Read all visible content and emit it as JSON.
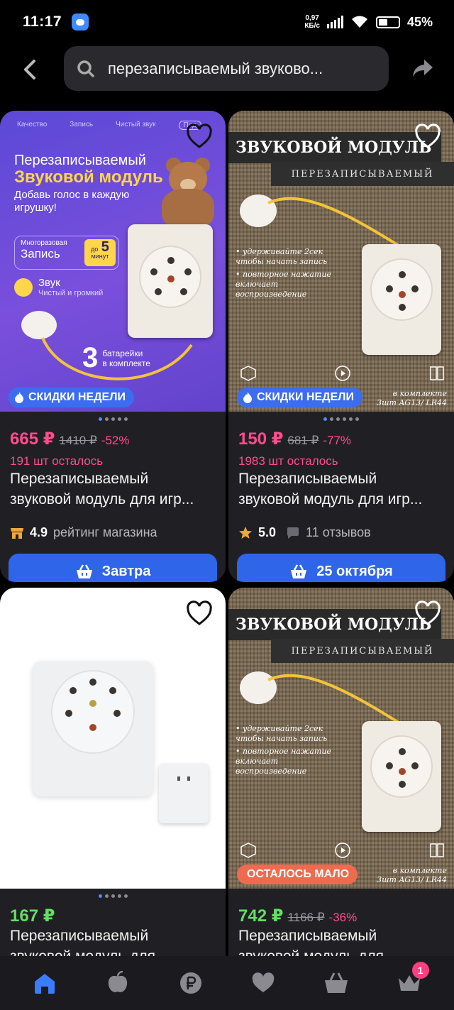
{
  "status_bar": {
    "time": "11:17",
    "speed_value": "0,97",
    "speed_unit": "КБ/с",
    "battery": "45%"
  },
  "header": {
    "search_query": "перезаписываемый звуково..."
  },
  "cards": [
    {
      "badge": "СКИДКИ НЕДЕЛИ",
      "price": "665 ₽",
      "old_price": "1410 ₽",
      "discount": "-52%",
      "stock": "191 шт осталось",
      "title_line1": "Перезаписываемый",
      "title_line2": "звуковой модуль для игр...",
      "rating": "4.9",
      "rating_label": "рейтинг магазина",
      "delivery": "Завтра",
      "image": {
        "tabs": [
          "Качество",
          "Запись",
          "Чистый звук",
          "Под"
        ],
        "headline1": "Перезаписываемый",
        "headline2": "Звуковой модуль",
        "tagline": "Добавь голос в каждую игрушку!",
        "reuse_label": "Многоразовая",
        "record_label": "Запись",
        "time_prefix": "до",
        "time_value": "5",
        "time_unit": "минут",
        "sound_title": "Звук",
        "sound_sub": "Чистый и громкий",
        "battery_count": "3",
        "battery_text1": "батарейки",
        "battery_text2": "в комплекте"
      }
    },
    {
      "badge": "СКИДКИ НЕДЕЛИ",
      "price": "150 ₽",
      "old_price": "681 ₽",
      "discount": "-77%",
      "stock": "1983 шт осталось",
      "title_line1": "Перезаписываемый",
      "title_line2": "звуковой модуль для игр...",
      "rating": "5.0",
      "reviews": "11 отзывов",
      "delivery": "25 октября",
      "image": {
        "banner": "ЗВУКОВОЙ МОДУЛЬ",
        "sub_banner": "ПЕРЕЗАПИСЫВАЕМЫЙ",
        "note1": "• удерживайте 2сек чтобы начать запись",
        "note2": "• повторное нажатие включает воспроизведение",
        "kit1": "в комплекте",
        "kit2": "3шт AG13/ LR44"
      }
    },
    {
      "price": "167 ₽",
      "title_line1": "Перезаписываемый",
      "title_line2": "звуковой модуль для..."
    },
    {
      "badge": "ОСТАЛОСЬ МАЛО",
      "price": "742 ₽",
      "old_price": "1166 ₽",
      "discount": "-36%",
      "title_line1": "Перезаписываемый",
      "title_line2": "звуковой модуль для...",
      "image": {
        "banner": "ЗВУКОВОЙ МОДУЛЬ",
        "sub_banner": "ПЕРЕЗАПИСЫВАЕМЫЙ",
        "note1": "• удерживайте 2сек чтобы начать запись",
        "note2": "• повторное нажатие включает воспроизведение",
        "kit1": "в комплекте",
        "kit2": "3шт AG13/ LR44"
      }
    }
  ],
  "bottom_nav": {
    "items": [
      "home-icon",
      "fruit-icon",
      "ruble-icon",
      "heart-icon",
      "cart-icon",
      "crown-icon"
    ],
    "cart_count": "1"
  },
  "colors": {
    "accent_blue": "#2f65e8",
    "price_pink": "#ff4d8d",
    "price_green": "#66dd66",
    "badge_orange": "#f06a4f"
  }
}
